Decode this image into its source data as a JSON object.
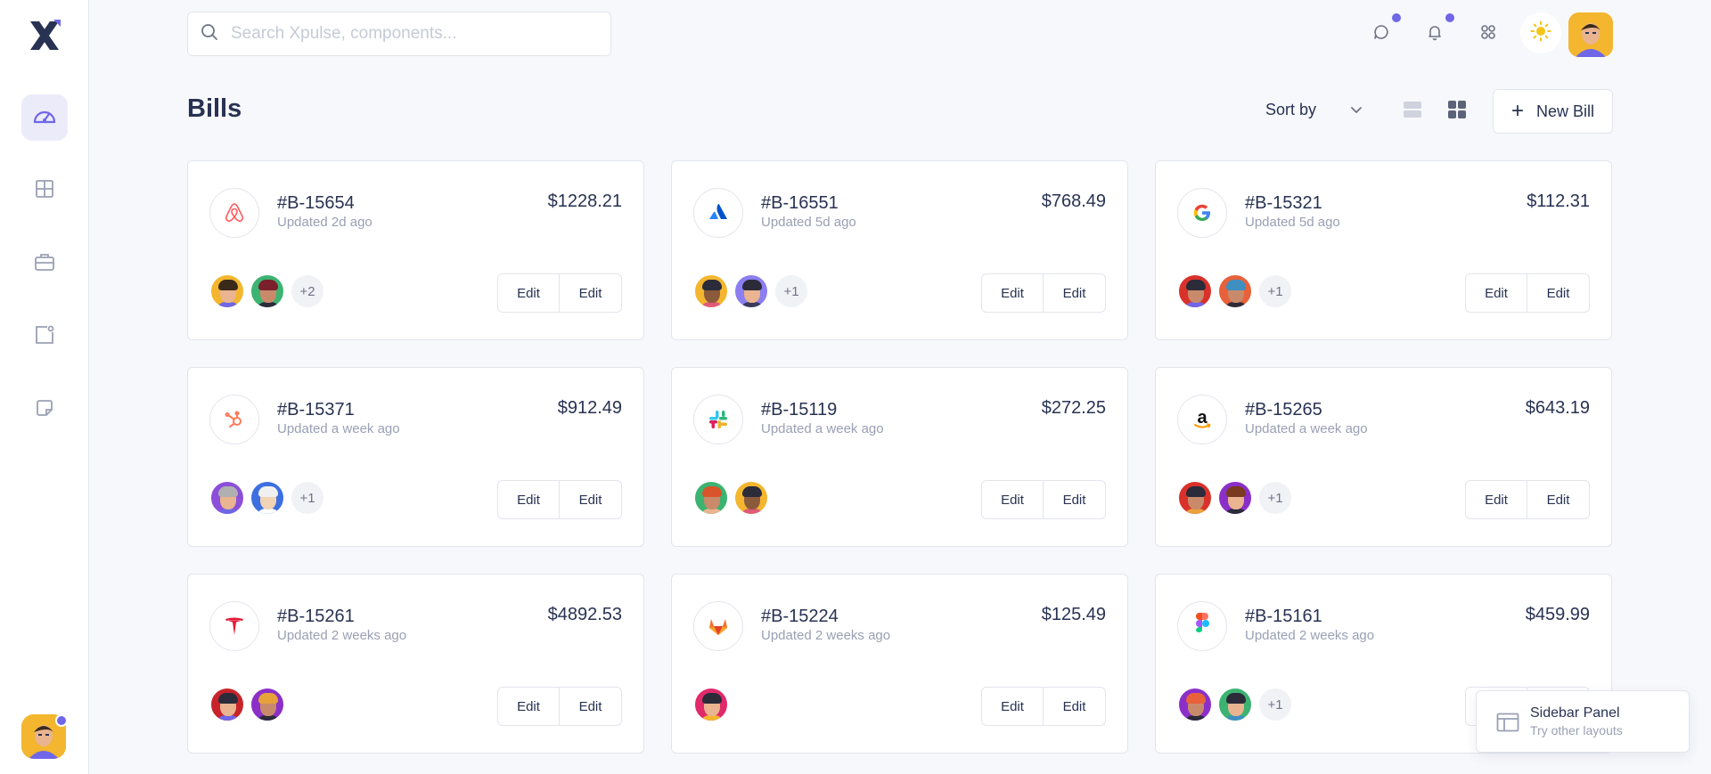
{
  "search": {
    "placeholder": "Search Xpulse, components..."
  },
  "page": {
    "title": "Bills"
  },
  "toolbar": {
    "sort_label": "Sort by",
    "new_bill_label": "New Bill"
  },
  "toast": {
    "title": "Sidebar Panel",
    "subtitle": "Try other layouts"
  },
  "colors": {
    "accent": "#6f66e8",
    "text": "#283252",
    "muted": "#9aa0b4",
    "background": "#f7f8fc"
  },
  "sidebar_icons": [
    "dashboard-gauge-icon",
    "grid-icon",
    "briefcase-icon",
    "app-square-icon",
    "sticky-note-icon"
  ],
  "bills": [
    {
      "company": "airbnb",
      "id": "#B-15654",
      "updated": "Updated 2d ago",
      "amount": "$1228.21",
      "more": "+2",
      "members": [
        [
          "#f3b62e",
          "#e9b48f",
          "#3a2a1a",
          "#6f66e8"
        ],
        [
          "#3cb371",
          "#c98a6b",
          "#7a1f2b",
          "#2b2b3a"
        ]
      ],
      "edit1": "Edit",
      "edit2": "Edit"
    },
    {
      "company": "atlassian",
      "id": "#B-16551",
      "updated": "Updated 5d ago",
      "amount": "$768.49",
      "more": "+1",
      "members": [
        [
          "#f3b62e",
          "#8a5a3b",
          "#2b2b3a",
          "#e05a7a"
        ],
        [
          "#8b7ef0",
          "#e9b48f",
          "#2b2b3a",
          "#3a3a5a"
        ]
      ],
      "edit1": "Edit",
      "edit2": "Edit"
    },
    {
      "company": "google",
      "id": "#B-15321",
      "updated": "Updated 5d ago",
      "amount": "$112.31",
      "more": "+1",
      "members": [
        [
          "#d9322a",
          "#c98a6b",
          "#2b2b3a",
          "#6f66e8"
        ],
        [
          "#e8613a",
          "#c98a6b",
          "#3f8fc0",
          "#2b2b3a"
        ]
      ],
      "edit1": "Edit",
      "edit2": "Edit"
    },
    {
      "company": "hubspot",
      "id": "#B-15371",
      "updated": "Updated a week ago",
      "amount": "$912.49",
      "more": "+1",
      "members": [
        [
          "#8b4fd9",
          "#e9b48f",
          "#b0b0b0",
          "#6f66e8"
        ],
        [
          "#3d6fe0",
          "#f1d3b5",
          "#f0f0f0",
          "#ffffff"
        ]
      ],
      "edit1": "Edit",
      "edit2": "Edit"
    },
    {
      "company": "slack",
      "id": "#B-15119",
      "updated": "Updated a week ago",
      "amount": "$272.25",
      "more": "",
      "members": [
        [
          "#3cb371",
          "#c98a6b",
          "#d9542a",
          "#e9b48f"
        ],
        [
          "#f3b62e",
          "#8a5a3b",
          "#2b2b3a",
          "#e05a7a"
        ]
      ],
      "edit1": "Edit",
      "edit2": "Edit"
    },
    {
      "company": "amazon",
      "id": "#B-15265",
      "updated": "Updated a week ago",
      "amount": "$643.19",
      "more": "+1",
      "members": [
        [
          "#d9322a",
          "#c98a6b",
          "#2b2b3a",
          "#e8a23a"
        ],
        [
          "#8b2fc9",
          "#e9b48f",
          "#7a3a1f",
          "#2b2b3a"
        ]
      ],
      "edit1": "Edit",
      "edit2": "Edit"
    },
    {
      "company": "tesla",
      "id": "#B-15261",
      "updated": "Updated 2 weeks ago",
      "amount": "$4892.53",
      "more": "",
      "members": [
        [
          "#c8232a",
          "#e9b48f",
          "#2b2b3a",
          "#6f66e8"
        ],
        [
          "#8b2fc9",
          "#c98a6b",
          "#e8a23a",
          "#2b2b3a"
        ]
      ],
      "edit1": "Edit",
      "edit2": "Edit"
    },
    {
      "company": "gitlab",
      "id": "#B-15224",
      "updated": "Updated 2 weeks ago",
      "amount": "$125.49",
      "more": "",
      "members": [
        [
          "#e02a6a",
          "#e9b48f",
          "#2b2b3a",
          "#f3b62e"
        ]
      ],
      "edit1": "Edit",
      "edit2": "Edit"
    },
    {
      "company": "figma",
      "id": "#B-15161",
      "updated": "Updated 2 weeks ago",
      "amount": "$459.99",
      "more": "+1",
      "members": [
        [
          "#8b2fc9",
          "#c98a6b",
          "#e8613a",
          "#2b2b3a"
        ],
        [
          "#3cb371",
          "#e9b48f",
          "#2b2b3a",
          "#3f8fc0"
        ]
      ],
      "edit1": "Edit",
      "edit2": "Edit"
    }
  ]
}
